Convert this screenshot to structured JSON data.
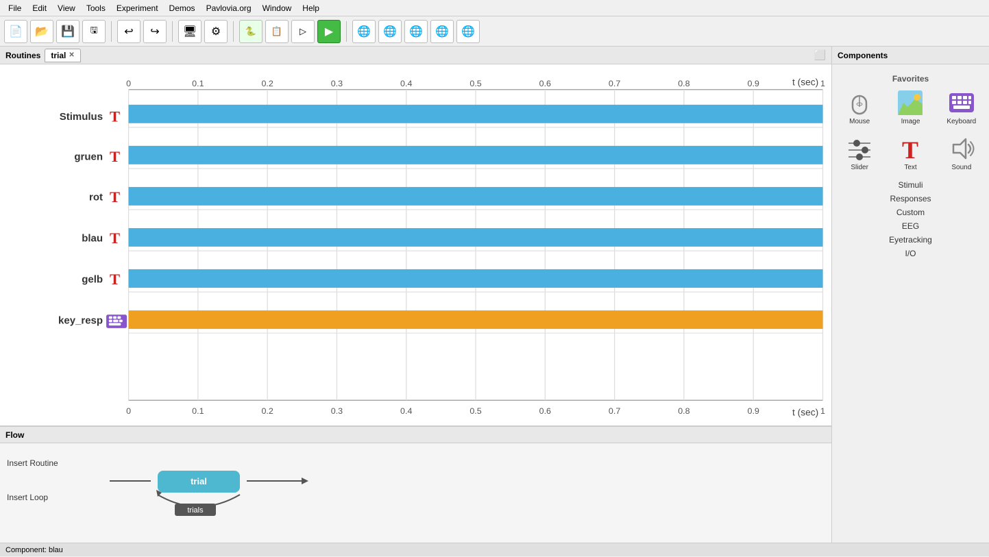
{
  "menubar": {
    "items": [
      "File",
      "Edit",
      "View",
      "Tools",
      "Experiment",
      "Demos",
      "Pavlovia.org",
      "Window",
      "Help"
    ]
  },
  "toolbar": {
    "buttons": [
      {
        "name": "new",
        "icon": "📄"
      },
      {
        "name": "open",
        "icon": "📂"
      },
      {
        "name": "save",
        "icon": "💾"
      },
      {
        "name": "save-as",
        "icon": "🖫"
      },
      {
        "name": "undo",
        "icon": "↩"
      },
      {
        "name": "redo",
        "icon": "↪"
      },
      {
        "name": "monitor",
        "icon": "🖥"
      },
      {
        "name": "settings",
        "icon": "⚙"
      },
      {
        "name": "python",
        "icon": "🐍"
      },
      {
        "name": "runner",
        "icon": "▶"
      },
      {
        "name": "run-web",
        "icon": "▷"
      },
      {
        "name": "run-green",
        "icon": "▶"
      },
      {
        "name": "globe1",
        "icon": "🌐"
      },
      {
        "name": "globe2",
        "icon": "🌐"
      },
      {
        "name": "globe3",
        "icon": "🌐"
      },
      {
        "name": "globe4",
        "icon": "🌐"
      },
      {
        "name": "globe5",
        "icon": "🌐"
      }
    ]
  },
  "routines": {
    "header": "Routines",
    "tab": "trial",
    "rows": [
      {
        "label": "Stimulus",
        "type": "text",
        "color": "#4ab0e0"
      },
      {
        "label": "gruen",
        "type": "text",
        "color": "#4ab0e0"
      },
      {
        "label": "rot",
        "type": "text",
        "color": "#4ab0e0"
      },
      {
        "label": "blau",
        "type": "text",
        "color": "#4ab0e0"
      },
      {
        "label": "gelb",
        "type": "text",
        "color": "#4ab0e0"
      },
      {
        "label": "key_resp",
        "type": "keyboard",
        "color": "#f0a020"
      }
    ],
    "axis_ticks": [
      "0",
      "0.1",
      "0.2",
      "0.3",
      "0.4",
      "0.5",
      "0.6",
      "0.7",
      "0.8",
      "0.9",
      "1"
    ],
    "axis_label": "t (sec)"
  },
  "flow": {
    "header": "Flow",
    "insert_routine_label": "Insert Routine",
    "insert_loop_label": "Insert Loop",
    "trial_node_label": "trial",
    "trials_label": "trials"
  },
  "components": {
    "header": "Components",
    "favorites_label": "Favorites",
    "items": [
      {
        "name": "Mouse",
        "type": "mouse"
      },
      {
        "name": "Image",
        "type": "image"
      },
      {
        "name": "Keyboard",
        "type": "keyboard"
      },
      {
        "name": "Slider",
        "type": "slider"
      },
      {
        "name": "Text",
        "type": "text"
      },
      {
        "name": "Sound",
        "type": "sound"
      }
    ],
    "sections": [
      "Stimuli",
      "Responses",
      "Custom",
      "EEG",
      "Eyetracking",
      "I/O"
    ]
  },
  "status_bar": {
    "text": "Component: blau"
  }
}
